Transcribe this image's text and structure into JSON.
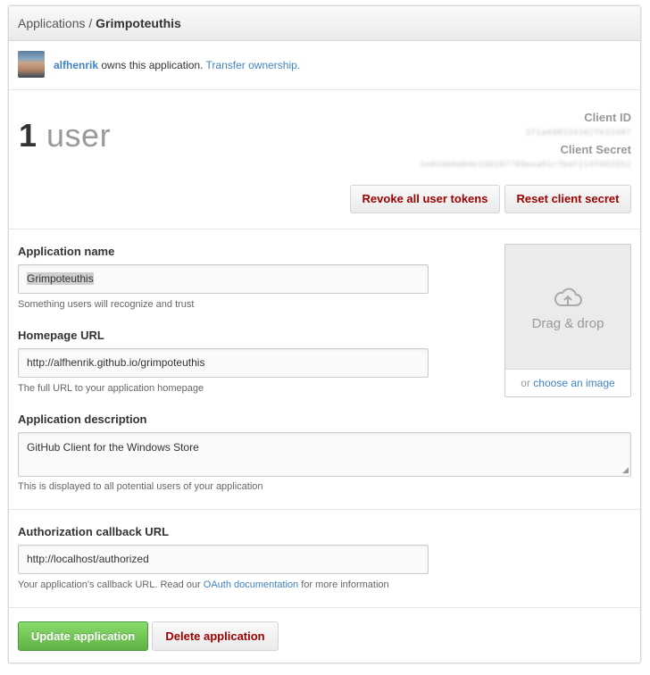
{
  "breadcrumb": {
    "parent": "Applications",
    "separator": " / ",
    "current": "Grimpoteuthis"
  },
  "owner": {
    "username": "alfhenrik",
    "text": " owns this application. ",
    "transfer_link": "Transfer ownership."
  },
  "stats": {
    "count": "1",
    "unit": " user"
  },
  "credentials": {
    "client_id_label": "Client ID",
    "client_id_value": "371a4d0334162fb32447",
    "client_secret_label": "Client Secret",
    "client_secret_value": "1e03469d04e1d0197799eea91c7bdf214f092552"
  },
  "actions": {
    "revoke": "Revoke all user tokens",
    "reset": "Reset client secret"
  },
  "form": {
    "name": {
      "label": "Application name",
      "value": "Grimpoteuthis",
      "help": "Something users will recognize and trust"
    },
    "homepage": {
      "label": "Homepage URL",
      "value": "http://alfhenrik.github.io/grimpoteuthis",
      "help": "The full URL to your application homepage"
    },
    "description": {
      "label": "Application description",
      "value": "GitHub Client for the Windows Store",
      "help": "This is displayed to all potential users of your application"
    },
    "callback": {
      "label": "Authorization callback URL",
      "value": "http://localhost/authorized",
      "help_prefix": "Your application's callback URL. Read our ",
      "help_link": "OAuth documentation",
      "help_suffix": " for more information"
    }
  },
  "logo_upload": {
    "drop_text": "Drag & drop",
    "or_text": "or ",
    "choose_link": "choose an image",
    "icon": "cloud-upload-icon"
  },
  "footer": {
    "update": "Update application",
    "delete": "Delete application"
  },
  "colors": {
    "link": "#4183c4",
    "danger": "#990000",
    "primary": "#60b044"
  }
}
